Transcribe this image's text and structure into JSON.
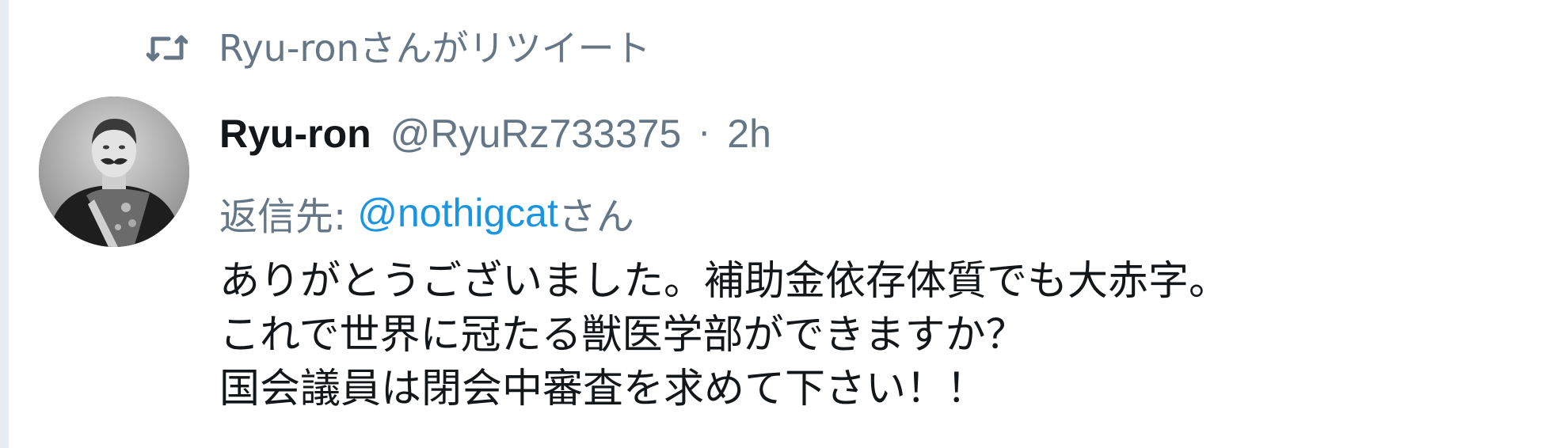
{
  "retweet": {
    "icon": "retweet-icon",
    "text": "Ryu-ronさんがリツイート"
  },
  "tweet": {
    "author": {
      "display_name": "Ryu-ron",
      "handle": "@RyuRz733375",
      "avatar_icon": "portrait-photo"
    },
    "separator": "·",
    "time": "2h",
    "reply": {
      "prefix": "返信先:",
      "mention": "@nothigcat",
      "suffix": "さん"
    },
    "lines": [
      "ありがとうございました。補助金依存体質でも大赤字。",
      "これで世界に冠たる獣医学部ができますか？",
      "国会議員は閉会中審査を求めて下さい！！"
    ]
  },
  "colors": {
    "text_primary": "#14171a",
    "text_secondary": "#657786",
    "link": "#1b95e0",
    "border": "#e6ecf0"
  }
}
